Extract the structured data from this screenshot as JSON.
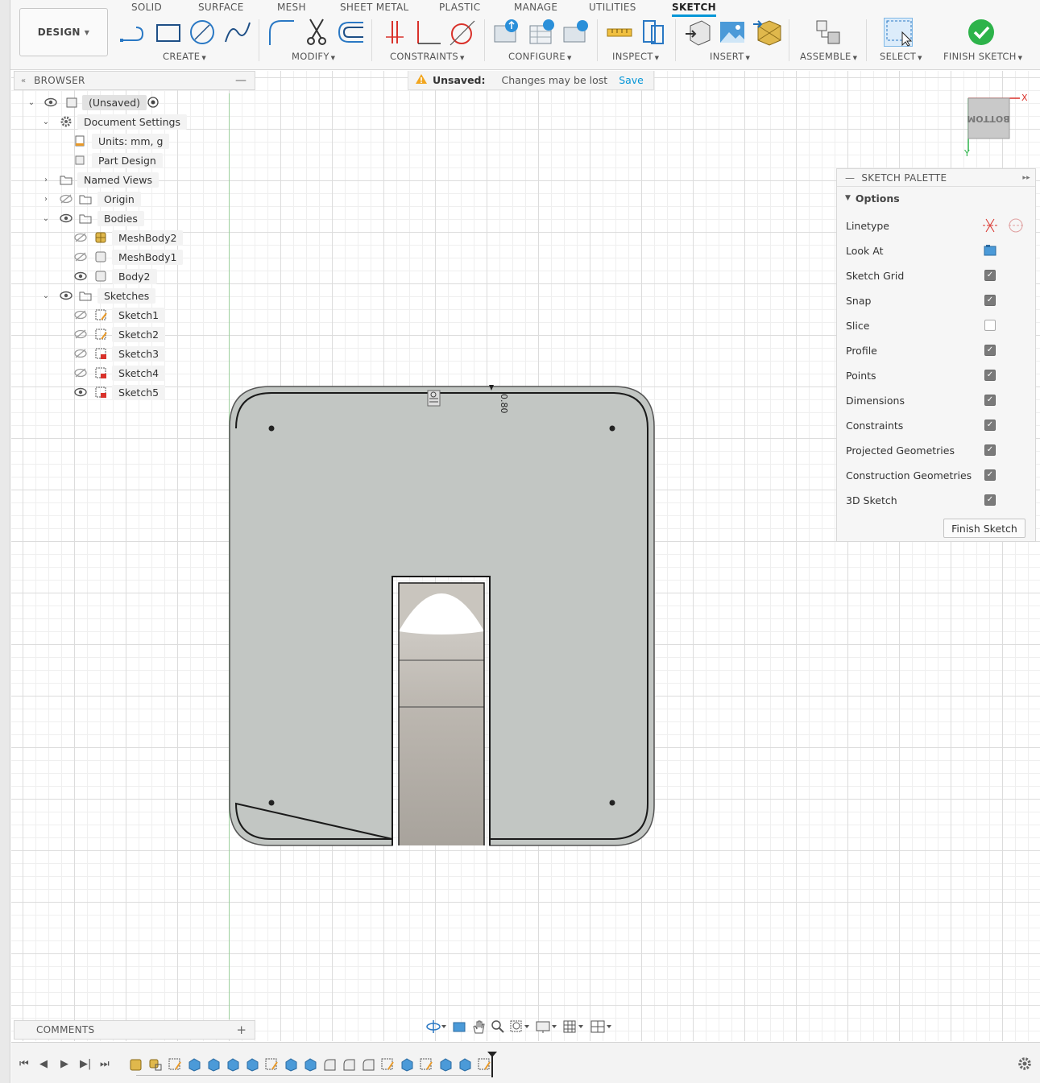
{
  "workspace": {
    "design_label": "DESIGN"
  },
  "tabs": [
    {
      "label": "SOLID",
      "active": false
    },
    {
      "label": "SURFACE",
      "active": false
    },
    {
      "label": "MESH",
      "active": false
    },
    {
      "label": "SHEET METAL",
      "active": false
    },
    {
      "label": "PLASTIC",
      "active": false
    },
    {
      "label": "MANAGE",
      "active": false
    },
    {
      "label": "UTILITIES",
      "active": false
    },
    {
      "label": "SKETCH",
      "active": true
    }
  ],
  "groups": {
    "create": "CREATE",
    "modify": "MODIFY",
    "constraints": "CONSTRAINTS",
    "configure": "CONFIGURE",
    "inspect": "INSPECT",
    "insert": "INSERT",
    "assemble": "ASSEMBLE",
    "select": "SELECT",
    "finish_sketch": "FINISH SKETCH"
  },
  "colors": {
    "accent": "#0696d7",
    "finish_green": "#2db34a",
    "sketch_red": "#d9322b"
  },
  "browser": {
    "title": "BROWSER",
    "root": "(Unsaved)",
    "items": {
      "document_settings": "Document Settings",
      "units": "Units: mm, g",
      "part_design": "Part Design",
      "named_views": "Named Views",
      "origin": "Origin",
      "bodies": "Bodies",
      "meshbody2": "MeshBody2",
      "meshbody1": "MeshBody1",
      "body2": "Body2",
      "sketches": "Sketches",
      "sketch1": "Sketch1",
      "sketch2": "Sketch2",
      "sketch3": "Sketch3",
      "sketch4": "Sketch4",
      "sketch5": "Sketch5"
    }
  },
  "unsaved_bar": {
    "label": "Unsaved:",
    "message": "Changes may be lost",
    "save": "Save"
  },
  "viewcube": {
    "face": "BOTTOM",
    "axis_x": "X",
    "axis_y": "Y"
  },
  "sketch_dimension": "0.80",
  "palette": {
    "title": "SKETCH PALETTE",
    "options_label": "Options",
    "linetype": "Linetype",
    "look_at": "Look At",
    "rows": [
      {
        "label": "Sketch Grid",
        "checked": true
      },
      {
        "label": "Snap",
        "checked": true
      },
      {
        "label": "Slice",
        "checked": false
      },
      {
        "label": "Profile",
        "checked": true
      },
      {
        "label": "Points",
        "checked": true
      },
      {
        "label": "Dimensions",
        "checked": true
      },
      {
        "label": "Constraints",
        "checked": true
      },
      {
        "label": "Projected Geometries",
        "checked": true
      },
      {
        "label": "Construction Geometries",
        "checked": true
      },
      {
        "label": "3D Sketch",
        "checked": true
      }
    ],
    "finish_button": "Finish Sketch"
  },
  "comments": {
    "title": "COMMENTS"
  }
}
